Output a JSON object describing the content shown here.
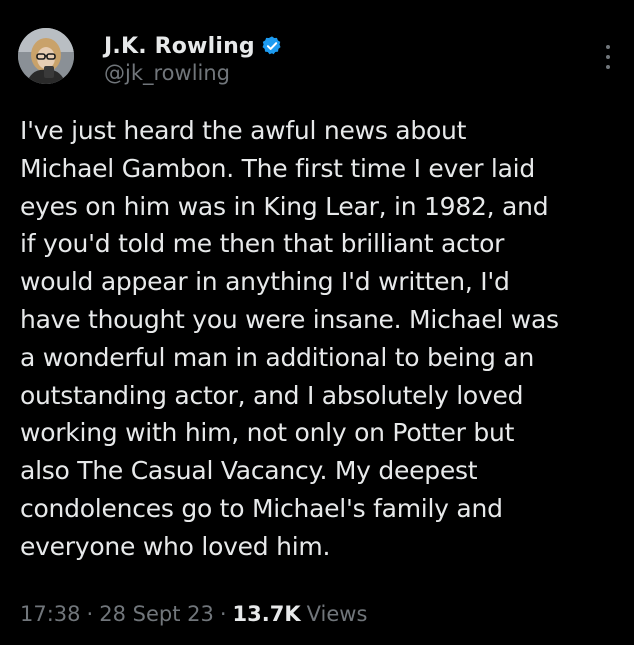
{
  "author": {
    "display_name": "J.K. Rowling",
    "handle": "@jk_rowling",
    "verified_icon": "verified-badge-icon"
  },
  "menu": {
    "icon": "more-vertical-icon"
  },
  "post": {
    "text": "I've just heard the awful news about\nMichael Gambon. The first time I ever laid\neyes on him was in King Lear, in 1982, and\nif you'd told me then that brilliant actor\nwould appear in anything I'd written, I'd\nhave thought you were insane. Michael was\na wonderful man in additional to being an\noutstanding actor, and I absolutely loved\nworking with him, not only on Potter but\nalso The Casual Vacancy. My deepest\ncondolences go to Michael's family and\neveryone who loved him."
  },
  "meta": {
    "time": "17:38",
    "separator": "·",
    "date": "28 Sept 23",
    "views_count": "13.7K",
    "views_label": "Views"
  },
  "colors": {
    "background": "#000000",
    "primary_text": "#e7e9ea",
    "secondary_text": "#71767b",
    "verified_blue": "#1d9bf0"
  }
}
